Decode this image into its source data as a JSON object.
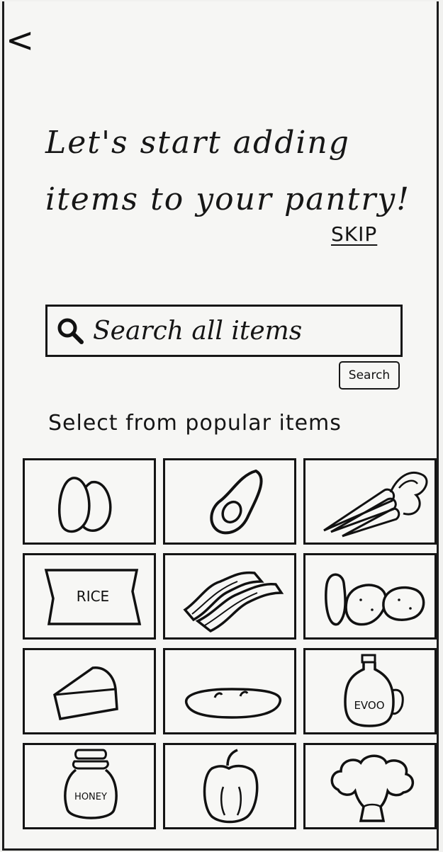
{
  "nav": {
    "back_icon": "chevron-left-icon",
    "back_glyph": "<"
  },
  "header": {
    "title": "Let's start adding items to your pantry!"
  },
  "skip_label": "SKIP",
  "search": {
    "placeholder": "Search all items",
    "button_label": "Search",
    "icon": "search-icon"
  },
  "popular": {
    "label": "Select from popular items",
    "items": [
      {
        "icon": "eggs-icon"
      },
      {
        "icon": "avocado-icon"
      },
      {
        "icon": "carrots-icon"
      },
      {
        "icon": "rice-icon",
        "text": "RICE"
      },
      {
        "icon": "bacon-icon"
      },
      {
        "icon": "potatoes-icon"
      },
      {
        "icon": "cheese-icon"
      },
      {
        "icon": "bread-icon"
      },
      {
        "icon": "olive-oil-icon",
        "text": "EVOO"
      },
      {
        "icon": "honey-icon",
        "text": "HONEY"
      },
      {
        "icon": "bell-pepper-icon"
      },
      {
        "icon": "broccoli-icon"
      }
    ]
  }
}
